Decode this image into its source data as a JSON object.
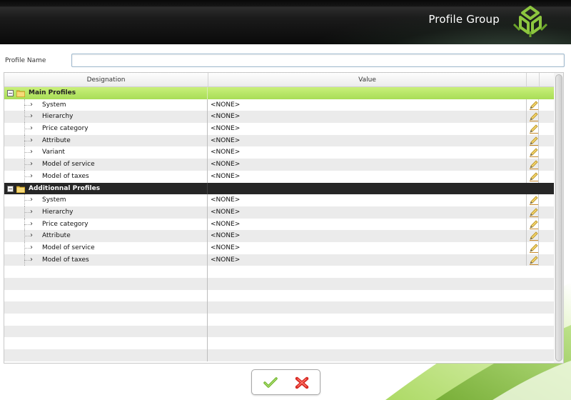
{
  "header": {
    "title": "Profile Group",
    "logo_icon": "cube-logo-icon"
  },
  "profile_name": {
    "label": "Profile Name",
    "value": "",
    "placeholder": ""
  },
  "grid": {
    "columns": {
      "designation": "Designation",
      "value": "Value"
    },
    "groups": [
      {
        "label": "Main Profiles",
        "items": [
          {
            "label": "System",
            "value": "<NONE>"
          },
          {
            "label": "Hierarchy",
            "value": "<NONE>"
          },
          {
            "label": "Price category",
            "value": "<NONE>"
          },
          {
            "label": "Attribute",
            "value": "<NONE>"
          },
          {
            "label": "Variant",
            "value": "<NONE>"
          },
          {
            "label": "Model of service",
            "value": "<NONE>"
          },
          {
            "label": "Model of taxes",
            "value": "<NONE>"
          }
        ]
      },
      {
        "label": "Additionnal Profiles",
        "items": [
          {
            "label": "System",
            "value": "<NONE>"
          },
          {
            "label": "Hierarchy",
            "value": "<NONE>"
          },
          {
            "label": "Price category",
            "value": "<NONE>"
          },
          {
            "label": "Attribute",
            "value": "<NONE>"
          },
          {
            "label": "Model of service",
            "value": "<NONE>"
          },
          {
            "label": "Model of taxes",
            "value": "<NONE>"
          }
        ]
      }
    ],
    "empty_rows": 8,
    "toggle_symbol": "−"
  },
  "colors": {
    "main_group": "#b4e364",
    "additional_group": "#262626",
    "accent_green": "#8dc63f",
    "cancel_red": "#e0302a"
  },
  "footer": {
    "ok_icon": "checkmark-icon",
    "cancel_icon": "cross-icon"
  }
}
